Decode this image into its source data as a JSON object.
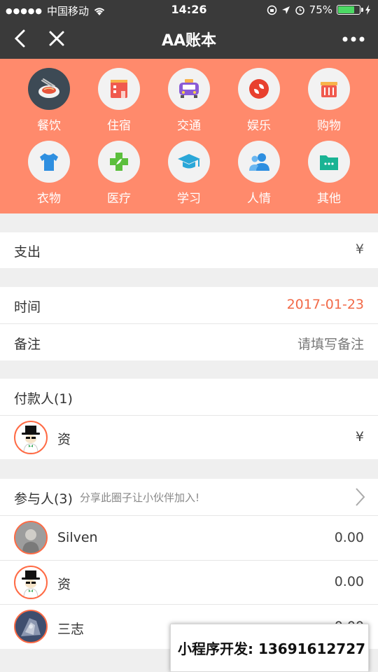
{
  "status_bar": {
    "carrier": "中国移动",
    "time": "14:26",
    "battery": "75%",
    "battery_level": 0.75,
    "icons": [
      "signal-icon",
      "wifi-icon",
      "orientation-lock-icon",
      "location-icon",
      "alarm-icon",
      "battery-icon",
      "charging-icon"
    ]
  },
  "navbar": {
    "title": "AA账本",
    "icons": [
      "back-icon",
      "close-icon",
      "more-icon"
    ]
  },
  "categories": [
    {
      "label": "餐饮",
      "icon": "food-icon",
      "active": true
    },
    {
      "label": "住宿",
      "icon": "hotel-icon"
    },
    {
      "label": "交通",
      "icon": "taxi-icon"
    },
    {
      "label": "娱乐",
      "icon": "entertainment-icon"
    },
    {
      "label": "购物",
      "icon": "shopping-basket-icon"
    },
    {
      "label": "衣物",
      "icon": "shirt-icon"
    },
    {
      "label": "医疗",
      "icon": "medical-cross-icon"
    },
    {
      "label": "学习",
      "icon": "graduation-cap-icon"
    },
    {
      "label": "人情",
      "icon": "people-icon"
    },
    {
      "label": "其他",
      "icon": "folder-icon"
    }
  ],
  "expense": {
    "label": "支出",
    "currency": "¥"
  },
  "time": {
    "label": "时间",
    "value": "2017-01-23"
  },
  "note": {
    "label": "备注",
    "placeholder": "请填写备注"
  },
  "payers": {
    "header": "付款人(1)",
    "list": [
      {
        "name": "资",
        "amount": "¥"
      }
    ]
  },
  "participants": {
    "header": "参与人(3)",
    "hint": "分享此圈子让小伙伴加入!",
    "list": [
      {
        "name": "Silven",
        "amount": "0.00"
      },
      {
        "name": "资",
        "amount": "0.00"
      },
      {
        "name": "三志",
        "amount": "0.00"
      }
    ]
  },
  "overlay": {
    "text": "小程序开发: 13691612727"
  },
  "colors": {
    "header_bg": "#3a3a3a",
    "category_bg": "#ff8a6c",
    "accent": "#ff6a44",
    "date": "#f26a48"
  }
}
